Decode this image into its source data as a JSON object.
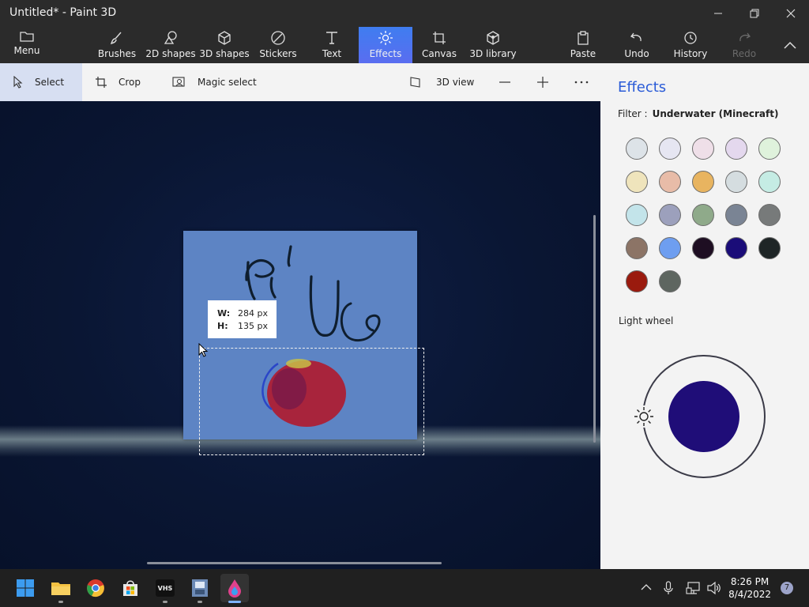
{
  "window": {
    "title": "Untitled* - Paint 3D"
  },
  "ribbon": {
    "items": [
      {
        "label": "Menu",
        "icon": "folder-icon"
      },
      {
        "label": "Brushes",
        "icon": "brush-icon"
      },
      {
        "label": "2D shapes",
        "icon": "2d-shapes-icon"
      },
      {
        "label": "3D shapes",
        "icon": "cube-icon"
      },
      {
        "label": "Stickers",
        "icon": "sticker-icon"
      },
      {
        "label": "Text",
        "icon": "text-icon"
      },
      {
        "label": "Effects",
        "icon": "sun-icon",
        "active": true
      },
      {
        "label": "Canvas",
        "icon": "crop-canvas-icon"
      },
      {
        "label": "3D library",
        "icon": "3d-library-icon"
      },
      {
        "label": "Paste",
        "icon": "paste-icon"
      },
      {
        "label": "Undo",
        "icon": "undo-icon"
      },
      {
        "label": "History",
        "icon": "history-icon"
      },
      {
        "label": "Redo",
        "icon": "redo-icon",
        "disabled": true
      }
    ]
  },
  "toolbar": {
    "select": "Select",
    "crop": "Crop",
    "magic_select": "Magic select",
    "view3d": "3D view"
  },
  "canvas": {
    "size_tip": {
      "w_label": "W:",
      "w_value": "284 px",
      "h_label": "H:",
      "h_value": "135 px"
    }
  },
  "effects_panel": {
    "title": "Effects",
    "filter_label": "Filter :",
    "filter_value": "Underwater (Minecraft)",
    "swatches": [
      "#dde3e8",
      "#e6e6f2",
      "#efdfe8",
      "#e4d8ee",
      "#dff2dc",
      "#efe4bc",
      "#e8bca8",
      "#e8b460",
      "#d5dde0",
      "#c5ece4",
      "#c3e4ea",
      "#9ca0bc",
      "#8faa8a",
      "#7a8494",
      "#777a7a",
      "#8c7466",
      "#6e9ef0",
      "#1e0e22",
      "#1a0c78",
      "#1e2526",
      "#9a1a0e",
      "#5e6660"
    ],
    "light_wheel_label": "Light wheel",
    "light_color": "#1f0d78"
  },
  "taskbar": {
    "apps": [
      "start-icon",
      "file-explorer-icon",
      "chrome-icon",
      "store-icon",
      "vhs-icon",
      "film-icon",
      "paint3d-icon"
    ],
    "vhs_label": "VHS",
    "time": "8:26 PM",
    "date": "8/4/2022",
    "notification_count": "7"
  }
}
